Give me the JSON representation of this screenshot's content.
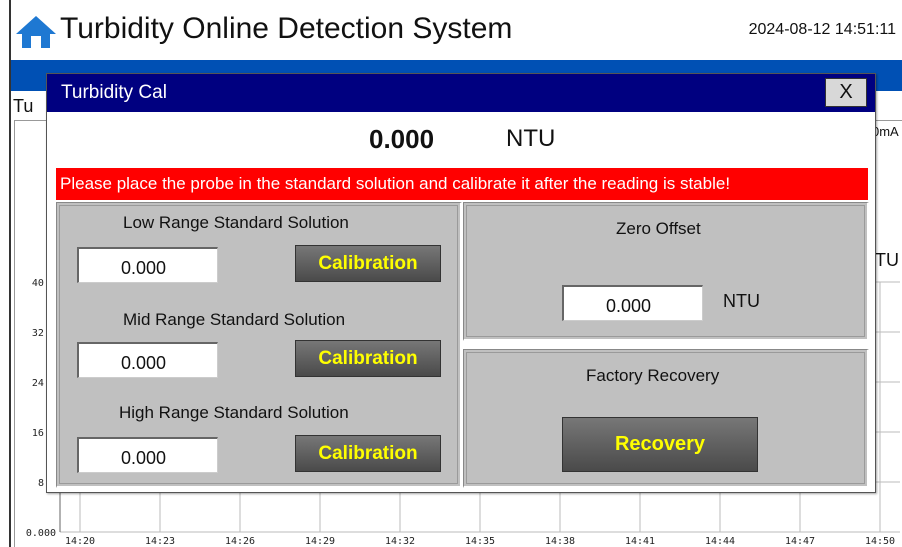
{
  "app": {
    "title": "Turbidity Online Detection System",
    "datetime": "2024-08-12 14:51:11",
    "tab_label_partial": "Tu",
    "unit_ma_partial": "0mA",
    "unit_ntu_partial": "TU",
    "icons": {
      "home": "home-icon"
    },
    "colors": {
      "header_bar": "#0050b4"
    }
  },
  "chart": {
    "y_ticks": [
      "40.0",
      "32.0",
      "24.0",
      "16.0",
      "8.0",
      "0.000"
    ],
    "x_ticks": [
      "14:20",
      "14:23",
      "14:26",
      "14:29",
      "14:32",
      "14:35",
      "14:38",
      "14:41",
      "14:44",
      "14:47",
      "14:50"
    ]
  },
  "dialog": {
    "title": "Turbidity Cal",
    "close_label": "X",
    "reading": {
      "value": "0.000",
      "unit": "NTU"
    },
    "warning": "Please place the probe in the standard solution and calibrate it after the reading is stable!",
    "colors": {
      "titlebar": "#000080",
      "warning_bg": "#ff0000",
      "button_text": "#ffff00"
    },
    "low": {
      "label": "Low Range Standard Solution",
      "value": "0.000",
      "button": "Calibration"
    },
    "mid": {
      "label": "Mid Range Standard Solution",
      "value": "0.000",
      "button": "Calibration"
    },
    "high": {
      "label": "High Range Standard Solution",
      "value": "0.000",
      "button": "Calibration"
    },
    "zero_offset": {
      "label": "Zero Offset",
      "value": "0.000",
      "unit": "NTU"
    },
    "factory": {
      "label": "Factory Recovery",
      "button": "Recovery"
    }
  }
}
